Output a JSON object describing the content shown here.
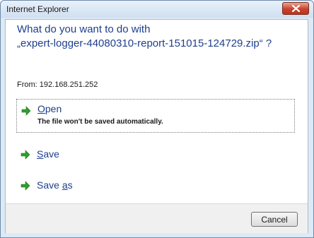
{
  "window": {
    "title": "Internet Explorer",
    "close_icon": "close-icon"
  },
  "dialog": {
    "question_line1": "What do you want to do with",
    "question_line2": "„expert-logger-44080310-report-151015-124729.zip“ ?",
    "from_label": "From: ",
    "from_value": "192.168.251.252"
  },
  "options": [
    {
      "label_mnemonic": "O",
      "label_rest": "pen",
      "description": "The file won't be saved automatically.",
      "icon": "green-arrow-icon"
    },
    {
      "label_mnemonic": "S",
      "label_rest": "ave",
      "icon": "green-arrow-icon"
    },
    {
      "label_prefix": "Save ",
      "label_mnemonic": "a",
      "label_rest": "s",
      "icon": "green-arrow-icon"
    }
  ],
  "footer": {
    "cancel_label": "Cancel"
  },
  "colors": {
    "heading_blue": "#1e3e8e",
    "arrow_green": "#2f9e2f",
    "close_red": "#c9412a",
    "frame_blue": "#dde9f5"
  }
}
